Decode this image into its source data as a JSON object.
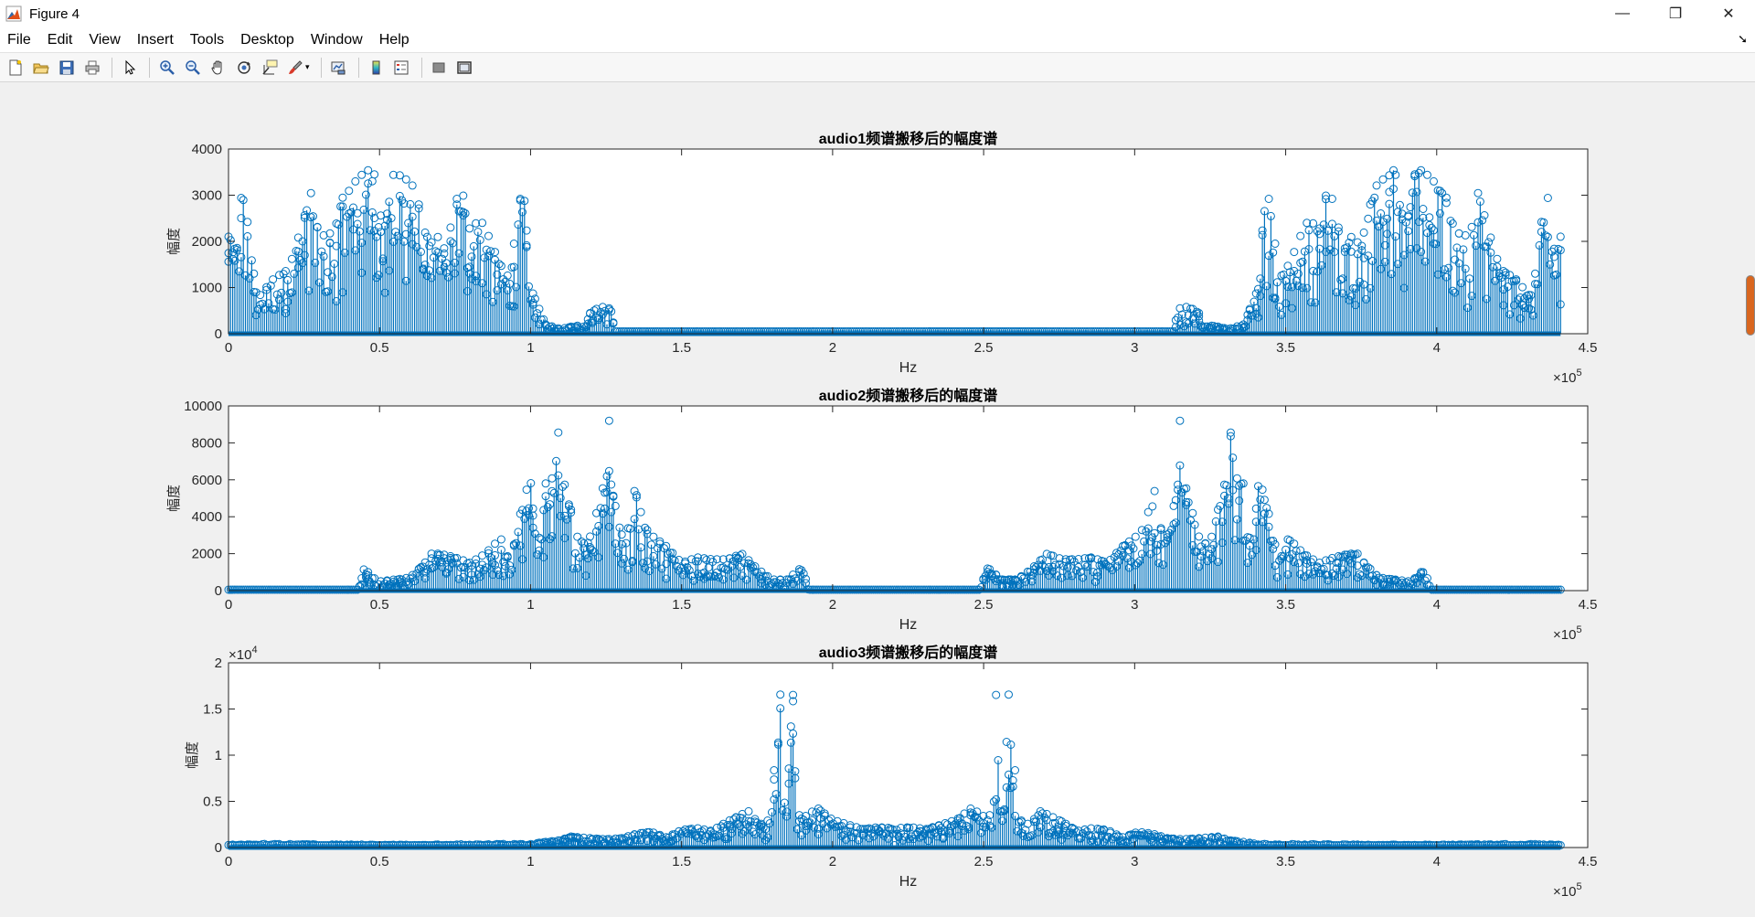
{
  "window": {
    "title": "Figure 4",
    "controls": [
      "—",
      "❐",
      "✕"
    ]
  },
  "menu": {
    "items": [
      "File",
      "Edit",
      "View",
      "Insert",
      "Tools",
      "Desktop",
      "Window",
      "Help"
    ]
  },
  "toolbar": {
    "buttons": [
      "new-figure-icon",
      "open-file-icon",
      "save-icon",
      "print-icon",
      "select-arrow-icon",
      "zoom-in-icon",
      "zoom-out-icon",
      "pan-hand-icon",
      "rotate-3d-icon",
      "data-cursor-icon",
      "brush-icon",
      "link-plot-icon",
      "colorbar-icon",
      "legend-icon",
      "hide-plot-tools-icon",
      "show-plot-tools-icon"
    ]
  },
  "colors": {
    "stem": "#0072BD",
    "axes_bg": "#ffffff",
    "figure_bg": "#f0f0f0"
  },
  "chart_data": [
    {
      "type": "stem",
      "title": "audio1频谱搬移后的幅度谱",
      "xlabel": "Hz",
      "ylabel": "幅度",
      "xlim": [
        0,
        450000
      ],
      "ylim": [
        0,
        4000
      ],
      "xtick_labels": [
        "0",
        "0.5",
        "1",
        "1.5",
        "2",
        "2.5",
        "3",
        "3.5",
        "4",
        "4.5"
      ],
      "ytick_labels": [
        "0",
        "1000",
        "2000",
        "3000",
        "4000"
      ],
      "x_exponent": "×10^5",
      "y_exponent": "",
      "x_data_max": 441000,
      "envelope_x": [
        0,
        1000,
        2000,
        3000,
        4000,
        5000,
        6000,
        7000,
        8000,
        9000,
        10000,
        15000,
        20000,
        25000,
        27000,
        30000,
        35000,
        38000,
        40000,
        42000,
        45000,
        48000,
        50000,
        52000,
        55000,
        57000,
        60000,
        62000,
        65000,
        68000,
        70000,
        72000,
        75000,
        78000,
        80000,
        83000,
        85000,
        88000,
        90000,
        93000,
        95000,
        97000,
        98000,
        100000,
        105000,
        110000,
        115000,
        118000,
        120000,
        125000,
        127000,
        128000
      ],
      "envelope_y": [
        2100,
        2000,
        1800,
        2200,
        2900,
        3100,
        2600,
        2000,
        1500,
        1000,
        800,
        1200,
        1400,
        2500,
        3150,
        2100,
        2200,
        3000,
        3100,
        3300,
        3500,
        3600,
        2600,
        2400,
        3600,
        3400,
        3300,
        3100,
        2200,
        1900,
        2200,
        1700,
        2900,
        3000,
        2200,
        2500,
        2300,
        1800,
        1500,
        1200,
        2200,
        3100,
        2900,
        1000,
        200,
        100,
        180,
        150,
        500,
        600,
        500,
        80
      ],
      "floor_y": 50
    },
    {
      "type": "stem",
      "title": "audio2频谱搬移后的幅度谱",
      "xlabel": "Hz",
      "ylabel": "幅度",
      "xlim": [
        0,
        450000
      ],
      "ylim": [
        0,
        10000
      ],
      "xtick_labels": [
        "0",
        "0.5",
        "1",
        "1.5",
        "2",
        "2.5",
        "3",
        "3.5",
        "4",
        "4.5"
      ],
      "ytick_labels": [
        "0",
        "2000",
        "4000",
        "6000",
        "8000",
        "10000"
      ],
      "x_exponent": "×10^5",
      "y_exponent": "",
      "x_data_max": 441000,
      "envelope_x": [
        0,
        43000,
        44000,
        45000,
        47000,
        50000,
        55000,
        60000,
        65000,
        67000,
        70000,
        75000,
        80000,
        85000,
        88000,
        90000,
        93000,
        95000,
        97000,
        100000,
        101000,
        103000,
        105000,
        108000,
        109000,
        110000,
        112000,
        115000,
        118000,
        120000,
        123000,
        125000,
        126000,
        127000,
        130000,
        133000,
        135000,
        137000,
        140000,
        145000,
        150000,
        155000,
        160000,
        165000,
        170000,
        175000,
        180000,
        185000,
        190000,
        191000,
        192000
      ],
      "envelope_y": [
        50,
        50,
        600,
        1300,
        800,
        500,
        600,
        700,
        1500,
        2000,
        2000,
        1800,
        1500,
        2000,
        2500,
        2900,
        1600,
        2800,
        4500,
        6200,
        4000,
        2800,
        5800,
        6200,
        9200,
        6000,
        5600,
        3000,
        2500,
        3000,
        5000,
        6200,
        9200,
        5500,
        3000,
        3500,
        6200,
        3600,
        3000,
        2400,
        1500,
        1800,
        1700,
        1700,
        2000,
        1200,
        600,
        600,
        1300,
        700,
        50
      ],
      "floor_y": 50
    },
    {
      "type": "stem",
      "title": "audio3频谱搬移后的幅度谱",
      "xlabel": "Hz",
      "ylabel": "幅度",
      "xlim": [
        0,
        450000
      ],
      "ylim": [
        0,
        20000
      ],
      "xtick_labels": [
        "0",
        "0.5",
        "1",
        "1.5",
        "2",
        "2.5",
        "3",
        "3.5",
        "4",
        "4.5"
      ],
      "ytick_labels": [
        "0",
        "0.5",
        "1",
        "1.5",
        "2"
      ],
      "x_exponent": "×10^5",
      "y_exponent": "×10^4",
      "x_data_max": 441000,
      "envelope_x": [
        0,
        10000,
        50000,
        100000,
        110000,
        113000,
        120000,
        125000,
        130000,
        135000,
        140000,
        145000,
        150000,
        155000,
        160000,
        165000,
        170000,
        172000,
        175000,
        178000,
        180000,
        182000,
        183000,
        184000,
        185000,
        186000,
        187000,
        188000,
        189000,
        190000,
        192000,
        195000,
        200000,
        205000,
        210000,
        215000,
        220000
      ],
      "envelope_y": [
        300,
        400,
        300,
        400,
        800,
        1200,
        1000,
        900,
        1000,
        1500,
        1700,
        1100,
        1900,
        2100,
        1800,
        2800,
        3600,
        4000,
        2800,
        2300,
        4800,
        16700,
        16500,
        5000,
        3600,
        16700,
        16500,
        4000,
        3500,
        3200,
        3600,
        4300,
        3000,
        2500,
        2000,
        2200,
        2100
      ],
      "floor_y": 250
    }
  ]
}
